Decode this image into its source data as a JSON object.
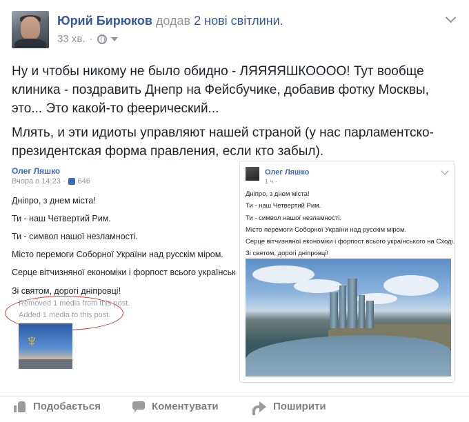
{
  "post": {
    "author": "Юрий Бирюков",
    "added_text": "додав",
    "photos_link": "2 нові світлини.",
    "time": "33 хв.",
    "paragraphs": [
      "Ну и чтобы никому не было обидно - ЛЯЯЯЯШКОООО! Тут вообще клиника - поздравить Днепр на Фейсбучике, добавив фотку Москвы, это... Это какой-то феерический...",
      "Млять, и эти идиоты управляют нашей страной (у нас парламентско-президентская форма правления, если кто забыл)."
    ]
  },
  "left_screenshot": {
    "author": "Олег Ляшко",
    "meta": "Вчора о 14:23 ·",
    "likes": "646",
    "lines": [
      "Дніпро, з днем міста!",
      "Ти - наш Четвертий Рим.",
      "Ти - символ нашої незламності.",
      "Місто перемоги Соборної України над русскім міром.",
      "Серце вітчизняної економіки і форпост всього українського на С",
      "Зі святом, дорогі дніпровці!"
    ],
    "edit_removed": "Removed 1 media from this post.",
    "edit_added": "Added 1 media to this post."
  },
  "right_screenshot": {
    "author": "Олег Ляшко",
    "meta": "1 ч ·",
    "lines": [
      "Дніпро, з днем міста!",
      "Ти - наш Четвертий Рим.",
      "Ти - символ нашої незламності.",
      "Місто перемоги Соборної України над русскім міром.",
      "Серце вітчизняної економіки і форпост всього українського на Сході.",
      "Зі святом, дорогі дніпровці!"
    ]
  },
  "actions": {
    "like": "Подобається",
    "comment": "Коментувати",
    "share": "Поширити"
  },
  "colors": {
    "link": "#365899",
    "text": "#1d2129",
    "muted": "#90949c",
    "annotation": "#d33a3a"
  }
}
